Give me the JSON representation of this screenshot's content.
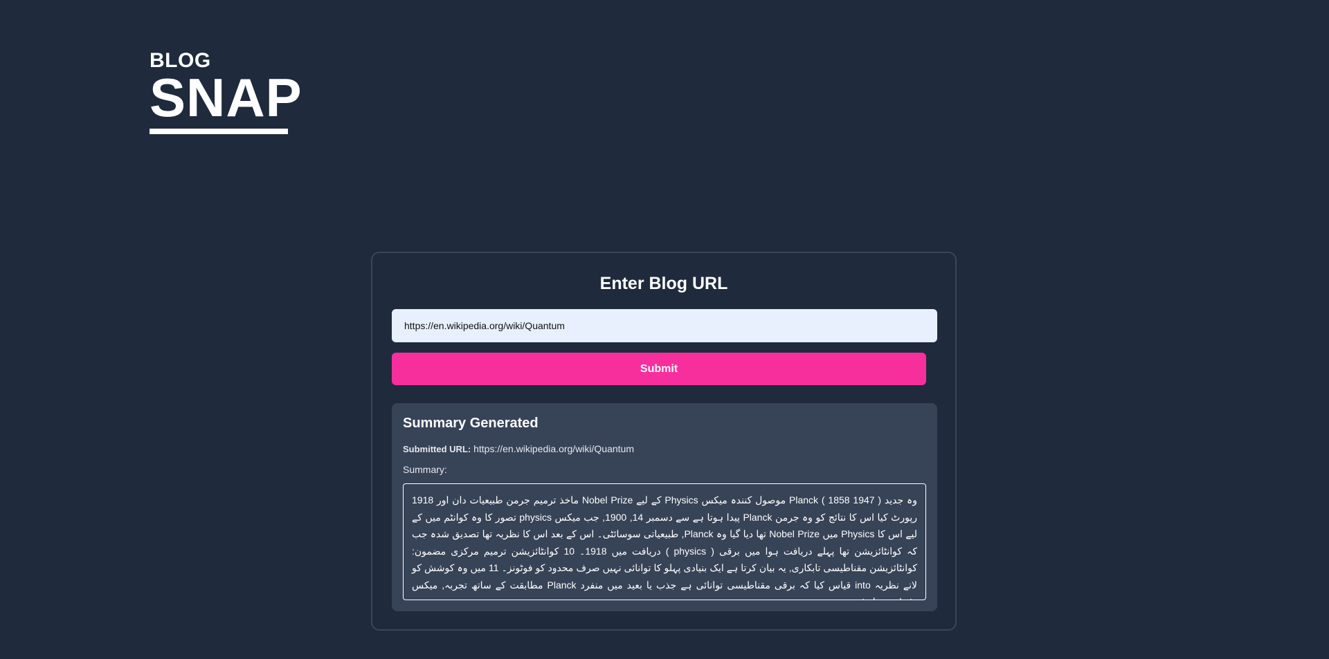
{
  "logo": {
    "top_text": "BLOG",
    "bottom_text": "SNAP"
  },
  "form": {
    "title": "Enter Blog URL",
    "url_value": "https://en.wikipedia.org/wiki/Quantum",
    "submit_label": "Submit"
  },
  "summary": {
    "heading": "Summary Generated",
    "submitted_url_label": "Submitted URL:",
    "submitted_url": "https://en.wikipedia.org/wiki/Quantum",
    "summary_label": "Summary:",
    "text": "وہ جدید ( 1947 1858 ) Planck موصول کنندہ میکس Physics کے لیے Nobel Prize ماخذ ترمیم جرمن طبیعیات دان اور 1918 رپورٹ کیا اس کا نتائج کو وہ جرمن Planck پیدا ہوتا ہے سے دسمبر 14, 1900, جب میکس physics تصور کا وہ کوانٹم میں کے لیے اس کا Physics میں Nobel Prize تھا دیا گیا وہ Planck, طبیعیاتی سوسائٹی۔ اس کے بعد اس کا نظریہ تھا تصدیق شدہ جب کہ کوانٹائزیشن تھا پہلے دریافت ہوا میں برقی ( physics ) دریافت میں 1918۔ 10 کوانٹائزیشن ترمیم مرکزی مضمون: کوانٹائزیشن مقناطیسی تابکاری, یہ بیان کرتا ہے ایک بنیادی پہلو کا توانائی نہیں صرف محدود کو فوٹونز۔ 11 میں وہ کوشش کو لانے نظریہ into قیاس کیا کہ برقی مقناطیسی توانائی ہے جذب یا بعید میں منفرد Planck مطابقت کے ساتھ تجربہ, میکس packets, یا quanta."
  }
}
